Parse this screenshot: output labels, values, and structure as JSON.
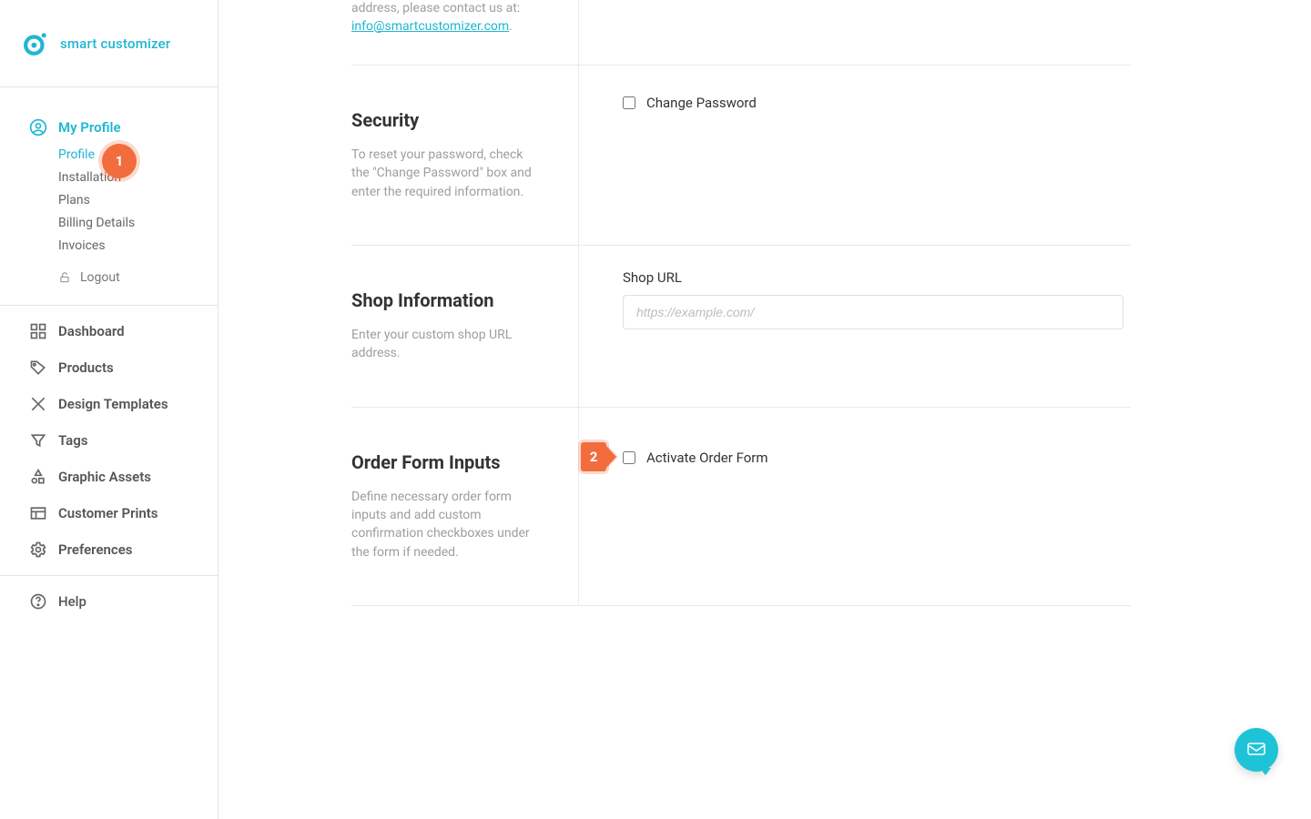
{
  "brand": "smart customizer",
  "sidebar": {
    "myProfile": "My Profile",
    "sub": {
      "profile": "Profile",
      "installation": "Installation",
      "plans": "Plans",
      "billing": "Billing Details",
      "invoices": "Invoices",
      "logout": "Logout"
    },
    "items": {
      "dashboard": "Dashboard",
      "products": "Products",
      "designTemplates": "Design Templates",
      "tags": "Tags",
      "graphicAssets": "Graphic Assets",
      "customerPrints": "Customer Prints",
      "preferences": "Preferences",
      "help": "Help"
    }
  },
  "top": {
    "descPrefix": "address, please contact us at:",
    "email": "info@smartcustomizer.com",
    "dot": "."
  },
  "security": {
    "title": "Security",
    "desc": "To reset your password, check the \"Change Password\" box and enter the required information.",
    "checkboxLabel": "Change Password"
  },
  "shop": {
    "title": "Shop Information",
    "desc": "Enter your custom shop URL address.",
    "fieldLabel": "Shop URL",
    "placeholder": "https://example.com/"
  },
  "order": {
    "title": "Order Form Inputs",
    "desc": "Define necessary order form inputs and add custom confirmation checkboxes under the form if needed.",
    "checkboxLabel": "Activate Order Form"
  },
  "badges": {
    "one": "1",
    "two": "2"
  }
}
